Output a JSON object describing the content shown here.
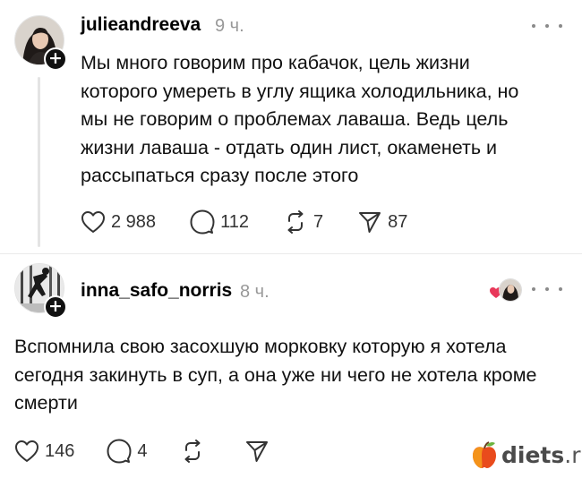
{
  "posts": [
    {
      "username": "julieandreeva",
      "time": "9 ч.",
      "text": "Мы много говорим про кабачок, цель жизни которого умереть в углу ящика холодильника, но мы не говорим о проблемах лаваша. Ведь цель жизни лаваша - отдать один лист, окаменеть и рассыпаться сразу после этого",
      "likes": "2 988",
      "replies": "112",
      "reposts": "7",
      "shares": "87"
    },
    {
      "username": "inna_safo_norris",
      "time": "8 ч.",
      "text": "Вспомнила свою засохшую морковку которую я хотела сегодня закинуть в суп, а она уже ни чего не хотела кроме смерти",
      "likes": "146",
      "replies": "4"
    }
  ],
  "badge": {
    "plus": "+"
  },
  "watermark": {
    "name": "diets",
    "tld": ".ru"
  },
  "icons": {
    "like": "heart-icon",
    "reply": "comment-icon",
    "repost": "repost-icon",
    "share": "send-icon",
    "more": "more-dots-icon"
  },
  "colors": {
    "accent_heart": "#e8385a",
    "muted": "#999999",
    "icon": "#333333"
  }
}
